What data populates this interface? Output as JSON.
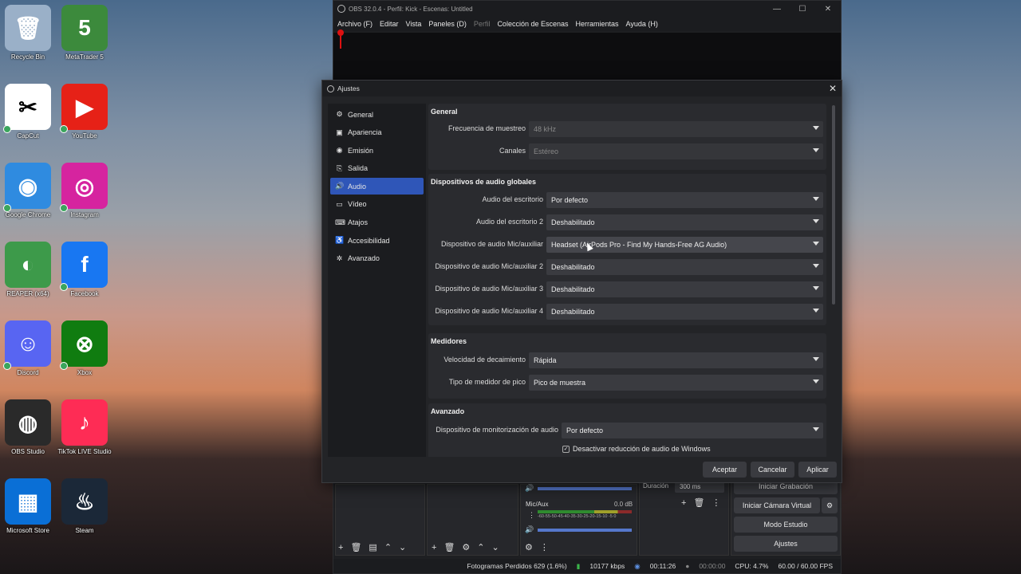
{
  "desktop": {
    "icons": [
      {
        "label": "Recycle Bin",
        "glyph": "🗑",
        "color": "#9ab0c8",
        "check": false
      },
      {
        "label": "MetaTrader 5",
        "glyph": "5",
        "color": "#3c8a3c",
        "check": false
      },
      {
        "label": "CapCut",
        "glyph": "✂",
        "color": "#ffffff",
        "check": true
      },
      {
        "label": "YouTube",
        "glyph": "▶",
        "color": "#e62117",
        "check": true
      },
      {
        "label": "Google Chrome",
        "glyph": "◉",
        "color": "#2f8be0",
        "check": true
      },
      {
        "label": "Instagram",
        "glyph": "◎",
        "color": "#d6249f",
        "check": true
      },
      {
        "label": "REAPER (x64)",
        "glyph": "◐",
        "color": "#3d9a4a",
        "check": false
      },
      {
        "label": "Facebook",
        "glyph": "f",
        "color": "#1877f2",
        "check": true
      },
      {
        "label": "Discord",
        "glyph": "☺",
        "color": "#5865f2",
        "check": true
      },
      {
        "label": "Xbox",
        "glyph": "⊗",
        "color": "#107c10",
        "check": true
      },
      {
        "label": "OBS Studio",
        "glyph": "◍",
        "color": "#2a2a2a",
        "check": false
      },
      {
        "label": "TikTok LIVE Studio",
        "glyph": "♪",
        "color": "#fe2c55",
        "check": false
      },
      {
        "label": "Microsoft Store",
        "glyph": "▦",
        "color": "#0a6fd6",
        "check": false
      },
      {
        "label": "Steam",
        "glyph": "♨",
        "color": "#1b2838",
        "check": false
      }
    ]
  },
  "obs": {
    "title": "OBS 32.0.4 - Perfil: Kick - Escenas: Untitled",
    "menu": [
      "Archivo (F)",
      "Editar",
      "Vista",
      "Paneles (D)",
      "Perfil",
      "Colección de Escenas",
      "Herramientas",
      "Ayuda (H)"
    ],
    "win_min": "—",
    "win_max": "☐",
    "win_close": "✕",
    "mixer": {
      "mic_label": "Mic/Aux",
      "mic_db": "0.0 dB",
      "scale": "-60-55-50-45-40-35-30-25-20-15-10 -5 0"
    },
    "transition": {
      "duration_label": "Duración",
      "duration_value": "300 ms"
    },
    "controls": {
      "start_recording": "Iniciar Grabación",
      "start_virtual_cam": "Iniciar Cámara Virtual",
      "studio_mode": "Modo Estudio",
      "settings": "Ajustes"
    },
    "status": {
      "dropped": "Fotogramas Perdidos 629 (1.6%)",
      "bitrate": "10177 kbps",
      "live_time": "00:11:26",
      "rec_time": "00:00:00",
      "cpu": "CPU: 4.7%",
      "fps": "60.00 / 60.00 FPS"
    }
  },
  "settings": {
    "title": "Ajustes",
    "close": "✕",
    "sidebar": [
      {
        "label": "General",
        "icon": "⚙",
        "active": false
      },
      {
        "label": "Apariencia",
        "icon": "▣",
        "active": false
      },
      {
        "label": "Emisión",
        "icon": "◉",
        "active": false
      },
      {
        "label": "Salida",
        "icon": "⎘",
        "active": false
      },
      {
        "label": "Audio",
        "icon": "🔊",
        "active": true
      },
      {
        "label": "Vídeo",
        "icon": "▭",
        "active": false
      },
      {
        "label": "Atajos",
        "icon": "⌨",
        "active": false
      },
      {
        "label": "Accesibilidad",
        "icon": "♿",
        "active": false
      },
      {
        "label": "Avanzado",
        "icon": "✲",
        "active": false
      }
    ],
    "general": {
      "title": "General",
      "sample_rate_label": "Frecuencia de muestreo",
      "sample_rate": "48 kHz",
      "channels_label": "Canales",
      "channels": "Estéreo"
    },
    "global_devices": {
      "title": "Dispositivos de audio globales",
      "desktop_label": "Audio del escritorio",
      "desktop": "Por defecto",
      "desktop2_label": "Audio del escritorio 2",
      "desktop2": "Deshabilitado",
      "mic_label": "Dispositivo de audio Mic/auxiliar",
      "mic": "Headset (AirPods Pro - Find My Hands-Free AG Audio)",
      "mic2_label": "Dispositivo de audio Mic/auxiliar 2",
      "mic2": "Deshabilitado",
      "mic3_label": "Dispositivo de audio Mic/auxiliar 3",
      "mic3": "Deshabilitado",
      "mic4_label": "Dispositivo de audio Mic/auxiliar 4",
      "mic4": "Deshabilitado"
    },
    "meters": {
      "title": "Medidores",
      "decay_label": "Velocidad de decaimiento",
      "decay": "Rápida",
      "peak_label": "Tipo de medidor de pico",
      "peak": "Pico de muestra"
    },
    "advanced": {
      "title": "Avanzado",
      "monitor_label": "Dispositivo de monitorización de audio",
      "monitor": "Por defecto",
      "ducking_label": "Desactivar reducción de audio de Windows",
      "ducking_checked": "✓"
    },
    "buttons": {
      "accept": "Aceptar",
      "cancel": "Cancelar",
      "apply": "Aplicar"
    }
  }
}
